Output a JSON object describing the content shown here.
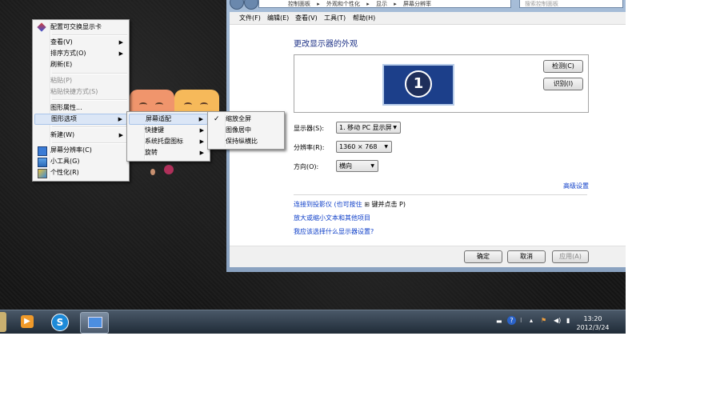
{
  "context_menu": {
    "items": [
      {
        "label": "配置可交换显示卡",
        "state": "normal",
        "icon": "graphics-card-icon"
      },
      {
        "label": "查看(V)",
        "state": "normal",
        "submenu": true
      },
      {
        "label": "排序方式(O)",
        "state": "normal",
        "submenu": true
      },
      {
        "label": "刷新(E)",
        "state": "normal"
      },
      {
        "label": "粘贴(P)",
        "state": "disabled"
      },
      {
        "label": "粘贴快捷方式(S)",
        "state": "disabled"
      },
      {
        "label": "图形属性...",
        "state": "normal"
      },
      {
        "label": "图形选项",
        "state": "highlighted",
        "submenu": true
      },
      {
        "label": "新建(W)",
        "state": "normal",
        "submenu": true
      },
      {
        "label": "屏幕分辨率(C)",
        "state": "normal",
        "icon": "screen-resolution-icon"
      },
      {
        "label": "小工具(G)",
        "state": "normal",
        "icon": "gadgets-icon"
      },
      {
        "label": "个性化(R)",
        "state": "normal",
        "icon": "personalize-icon"
      }
    ]
  },
  "graphics_submenu": {
    "items": [
      {
        "label": "屏幕适配",
        "state": "highlighted",
        "submenu": true
      },
      {
        "label": "快捷键",
        "submenu": true
      },
      {
        "label": "系统托盘图标",
        "submenu": true
      },
      {
        "label": "旋转",
        "submenu": true
      }
    ]
  },
  "fit_submenu": {
    "items": [
      {
        "label": "缩放全屏",
        "checked": true
      },
      {
        "label": "图像居中",
        "checked": false
      },
      {
        "label": "保持纵横比",
        "checked": false
      }
    ]
  },
  "window": {
    "breadcrumb": [
      "控制面板",
      "外观和个性化",
      "显示",
      "屏幕分辨率"
    ],
    "search_placeholder": "搜索控制面板",
    "menubar": [
      "文件(F)",
      "编辑(E)",
      "查看(V)",
      "工具(T)",
      "帮助(H)"
    ],
    "heading": "更改显示器的外观",
    "monitor_number": "1",
    "detect_button": "检测(C)",
    "identify_button": "识别(I)",
    "display_label": "显示器(S):",
    "display_value": "1. 移动 PC 显示屏",
    "resolution_label": "分辨率(R):",
    "resolution_value": "1360 × 768",
    "orientation_label": "方向(O):",
    "orientation_value": "横向",
    "advanced_link": "高级设置",
    "projector_link": "连接到投影仪 (也可按住",
    "projector_link_suffix": "键并点击 P)",
    "text_size_link": "放大或缩小文本和其他项目",
    "help_link": "我应该选择什么显示器设置?",
    "ok_button": "确定",
    "cancel_button": "取消",
    "apply_button": "应用(A)"
  },
  "taskbar": {
    "time": "13:20",
    "date": "2012/3/24"
  }
}
